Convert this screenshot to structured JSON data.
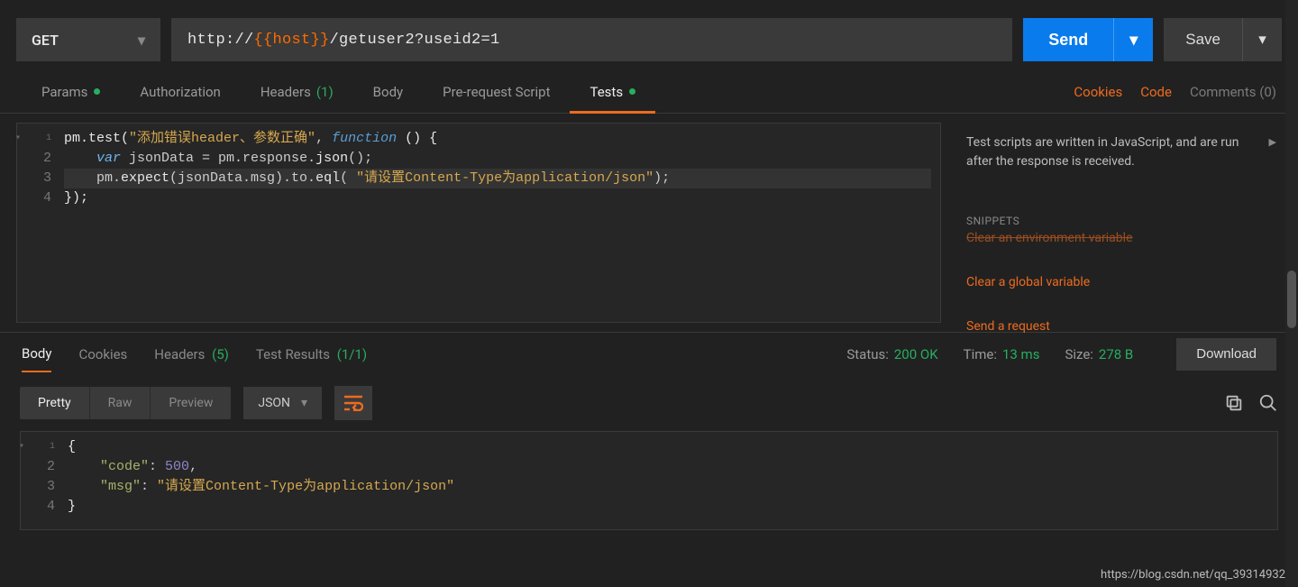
{
  "request": {
    "method": "GET",
    "url_parts": {
      "proto": "http://",
      "var": "{{host}}",
      "rest": "/getuser2?useid2=1"
    },
    "send_label": "Send",
    "save_label": "Save"
  },
  "tabs": {
    "params": "Params",
    "auth": "Authorization",
    "headers": "Headers",
    "headers_count": "(1)",
    "body": "Body",
    "prereq": "Pre-request Script",
    "tests": "Tests"
  },
  "right_links": {
    "cookies": "Cookies",
    "code": "Code",
    "comments": "Comments (0)"
  },
  "tests_code": {
    "l1a": "pm.",
    "l1b": "test",
    "l1c": "(",
    "l1d": "\"添加错误header、参数正确\"",
    "l1e": ", ",
    "l1f": "function",
    "l1g": " () {",
    "l2a": "    ",
    "l2b": "var",
    "l2c": " jsonData = pm.response.",
    "l2d": "json",
    "l2e": "();",
    "l3a": "    pm.",
    "l3b": "expect",
    "l3c": "(jsonData.msg).to.",
    "l3d": "eql",
    "l3e": "( ",
    "l3f": "\"请设置Content-Type为application/json\"",
    "l3g": ");",
    "l4": "});"
  },
  "side": {
    "desc": "Test scripts are written in JavaScript, and are run after the response is received.",
    "sn_title": "SNIPPETS",
    "sn_cut": "Clear an environment variable",
    "sn1": "Clear a global variable",
    "sn2": "Send a request"
  },
  "resp_tabs": {
    "body": "Body",
    "cookies": "Cookies",
    "headers": "Headers",
    "headers_count": "(5)",
    "testres": "Test Results",
    "testres_count": "(1/1)"
  },
  "status": {
    "status_lbl": "Status:",
    "status_val": "200 OK",
    "time_lbl": "Time:",
    "time_val": "13 ms",
    "size_lbl": "Size:",
    "size_val": "278 B",
    "download": "Download"
  },
  "bodybar": {
    "pretty": "Pretty",
    "raw": "Raw",
    "preview": "Preview",
    "format": "JSON"
  },
  "resp_body": {
    "l1": "{",
    "l2k": "\"code\"",
    "l2c": ": ",
    "l2v": "500",
    "l2t": ",",
    "l3k": "\"msg\"",
    "l3c": ": ",
    "l3v": "\"请设置Content-Type为application/json\"",
    "l4": "}"
  },
  "line_numbers": {
    "n1": "1",
    "n2": "2",
    "n3": "3",
    "n4": "4"
  },
  "watermark": "https://blog.csdn.net/qq_39314932"
}
